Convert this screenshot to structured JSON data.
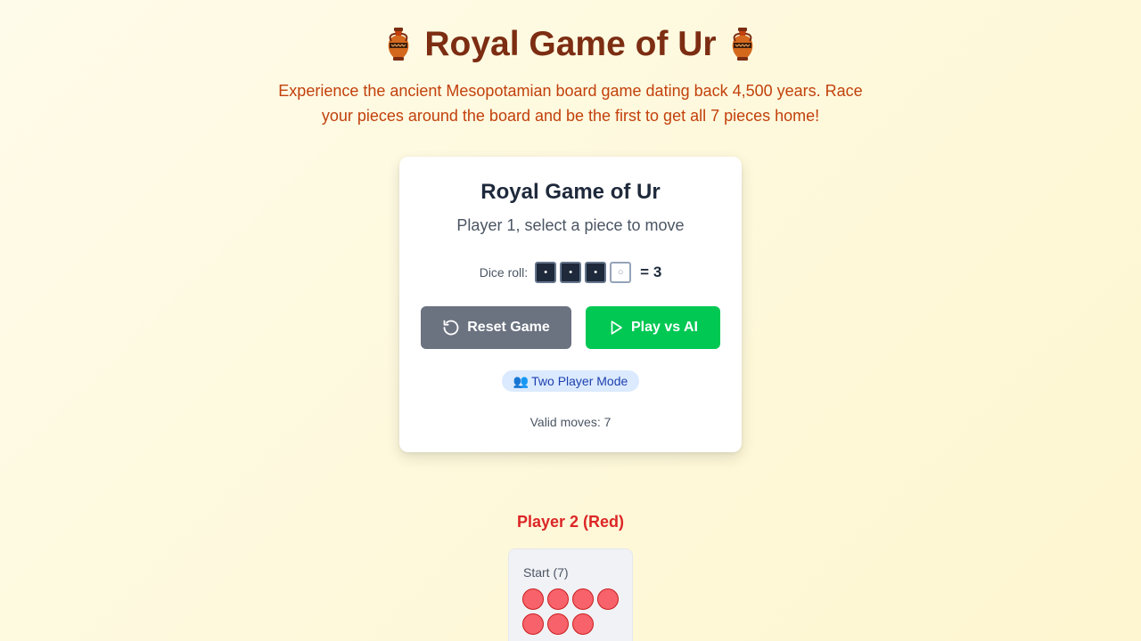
{
  "header": {
    "title": "Royal Game of Ur",
    "title_icon": "amphora-icon",
    "subtitle": "Experience the ancient Mesopotamian board game dating back 4,500 years. Race your pieces around the board and be the first to get all 7 pieces home!"
  },
  "game_card": {
    "title": "Royal Game of Ur",
    "status": "Player 1, select a piece to move",
    "dice": {
      "label": "Dice roll:",
      "values": [
        1,
        1,
        1,
        0
      ],
      "total_text": "= 3",
      "dark_symbol": "•",
      "light_symbol": "○"
    },
    "reset_label": "Reset Game",
    "ai_label": "Play vs AI",
    "mode_icon": "👥",
    "mode_label": "Two Player Mode",
    "valid_moves": "Valid moves: 7"
  },
  "player2": {
    "label": "Player 2 (Red)",
    "start_label": "Start (7)",
    "piece_count": 7,
    "color": "#f8626a"
  },
  "colors": {
    "title": "#7c2d12",
    "subtitle": "#c2410c",
    "reset_button": "#6b7280",
    "ai_button": "#00c853",
    "player2": "#dc2626"
  }
}
